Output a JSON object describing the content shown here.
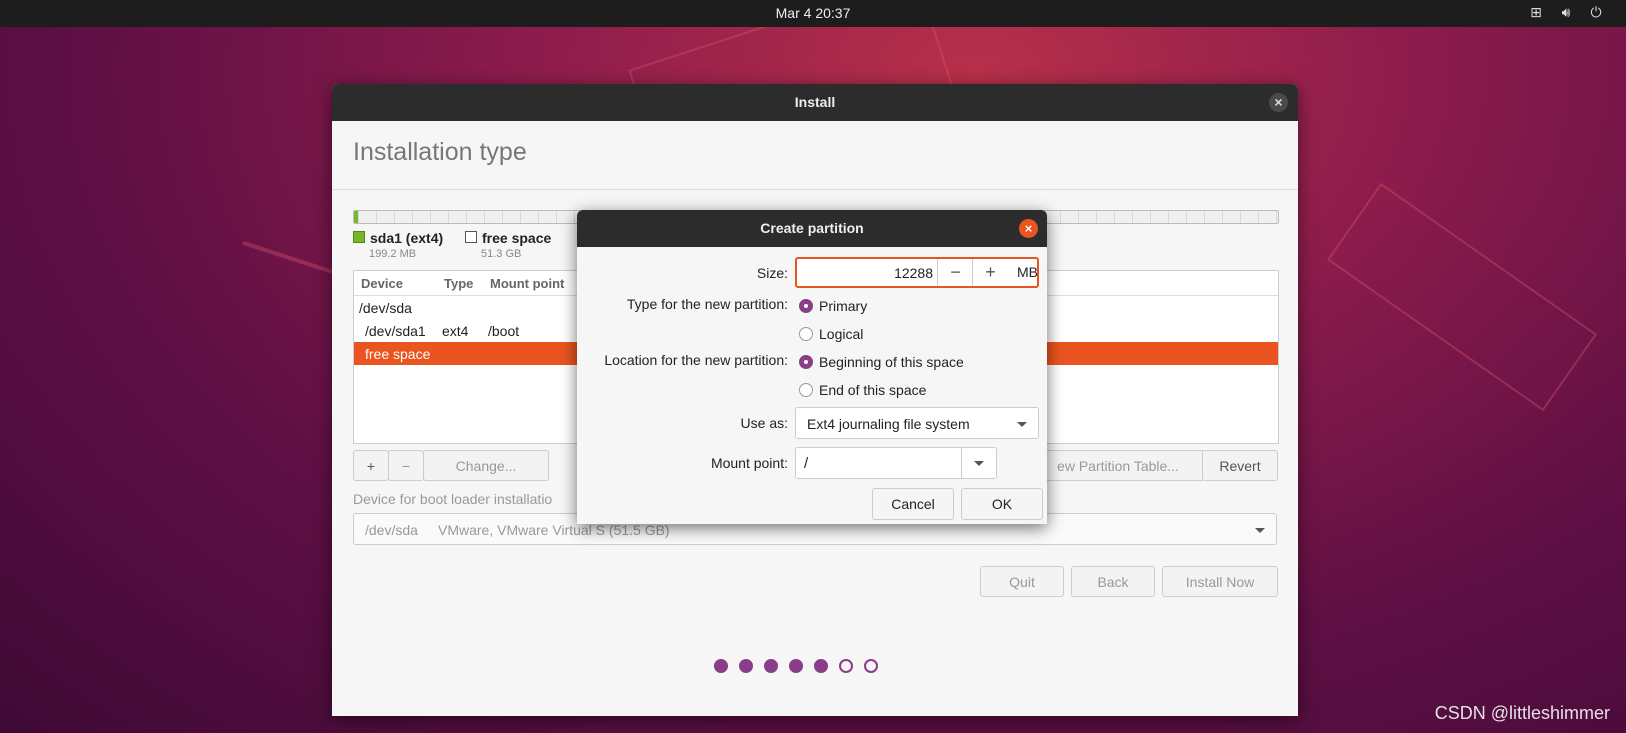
{
  "topbar": {
    "clock": "Mar 4  20:37",
    "icons": [
      "network-icon",
      "volume-icon",
      "power-icon"
    ]
  },
  "window": {
    "title": "Install",
    "page_title": "Installation type",
    "legend": [
      {
        "name": "sda1 (ext4)",
        "size": "199.2 MB",
        "color": "#76b82a"
      },
      {
        "name": "free space",
        "size": "51.3 GB",
        "color": "#ffffff"
      }
    ],
    "table": {
      "headers": [
        "Device",
        "Type",
        "Mount point"
      ],
      "rows": [
        {
          "device": "/dev/sda",
          "type": "",
          "mount": ""
        },
        {
          "device": "/dev/sda1",
          "type": "ext4",
          "mount": "/boot"
        },
        {
          "device": "free space",
          "type": "",
          "mount": "",
          "selected": true
        }
      ]
    },
    "buttons": {
      "add": "+",
      "remove": "−",
      "change": "Change...",
      "new_table": "ew Partition Table...",
      "revert": "Revert",
      "quit": "Quit",
      "back": "Back",
      "install": "Install Now"
    },
    "bootloader": {
      "label": "Device for boot loader installatio",
      "device": "/dev/sda",
      "desc": "VMware, VMware Virtual S (51.5 GB)"
    },
    "progress_dots": {
      "total": 7,
      "filled": 5
    }
  },
  "dialog": {
    "title": "Create partition",
    "size_label": "Size:",
    "size_value": "12288",
    "minus": "−",
    "plus": "+",
    "size_unit": "MB",
    "type_label": "Type for the new partition:",
    "type_options": [
      "Primary",
      "Logical"
    ],
    "type_selected": "Primary",
    "location_label": "Location for the new partition:",
    "location_options": [
      "Beginning of this space",
      "End of this space"
    ],
    "location_selected": "Beginning of this space",
    "use_as_label": "Use as:",
    "use_as_value": "Ext4 journaling file system",
    "mount_label": "Mount point:",
    "mount_value": "/",
    "cancel": "Cancel",
    "ok": "OK"
  },
  "watermark": "CSDN @littleshimmer",
  "accent": "#e95420",
  "purple": "#8a3d88"
}
